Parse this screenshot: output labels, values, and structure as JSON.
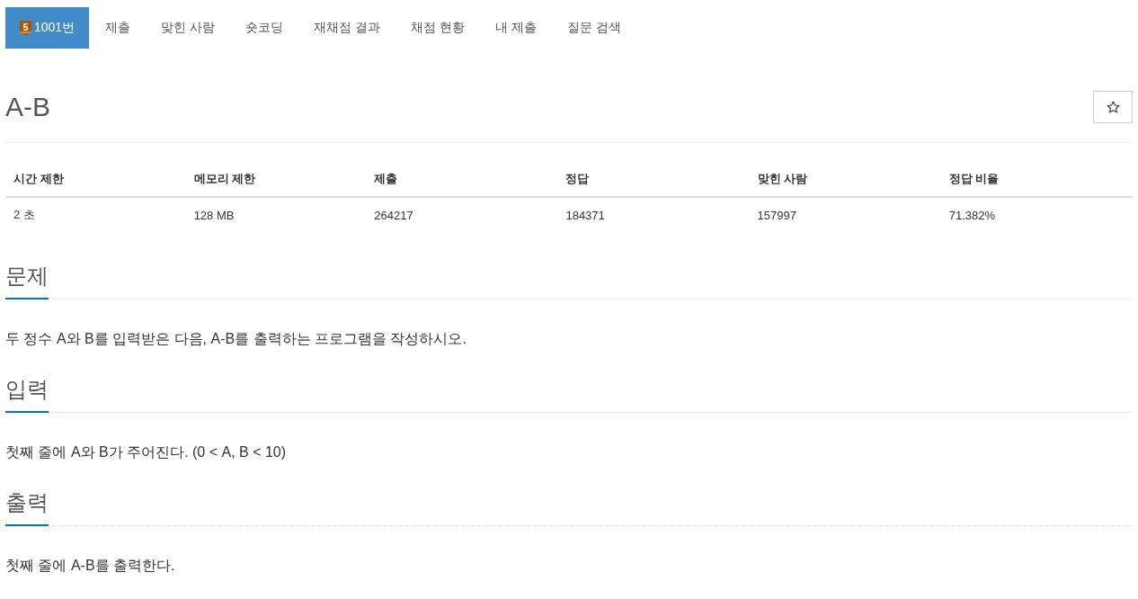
{
  "tabs": [
    {
      "label": "1001번",
      "badge": "5",
      "selected": true
    },
    {
      "label": "제출",
      "selected": false
    },
    {
      "label": "맞힌 사람",
      "selected": false
    },
    {
      "label": "숏코딩",
      "selected": false
    },
    {
      "label": "재채점 결과",
      "selected": false
    },
    {
      "label": "채점 현황",
      "selected": false
    },
    {
      "label": "내 제출",
      "selected": false
    },
    {
      "label": "질문 검색",
      "selected": false
    }
  ],
  "problem": {
    "title": "A-B",
    "starred": false
  },
  "stats": {
    "columns": [
      "시간 제한",
      "메모리 제한",
      "제출",
      "정답",
      "맞힌 사람",
      "정답 비율"
    ],
    "rows": [
      [
        "2 초",
        "128 MB",
        "264217",
        "184371",
        "157997",
        "71.382%"
      ]
    ]
  },
  "sections": [
    {
      "heading": "문제",
      "body": "두 정수 A와 B를 입력받은 다음, A-B를 출력하는 프로그램을 작성하시오."
    },
    {
      "heading": "입력",
      "body": "첫째 줄에 A와 B가 주어진다. (0 < A, B < 10)"
    },
    {
      "heading": "출력",
      "body": "첫째 줄에 A-B를 출력한다."
    }
  ]
}
